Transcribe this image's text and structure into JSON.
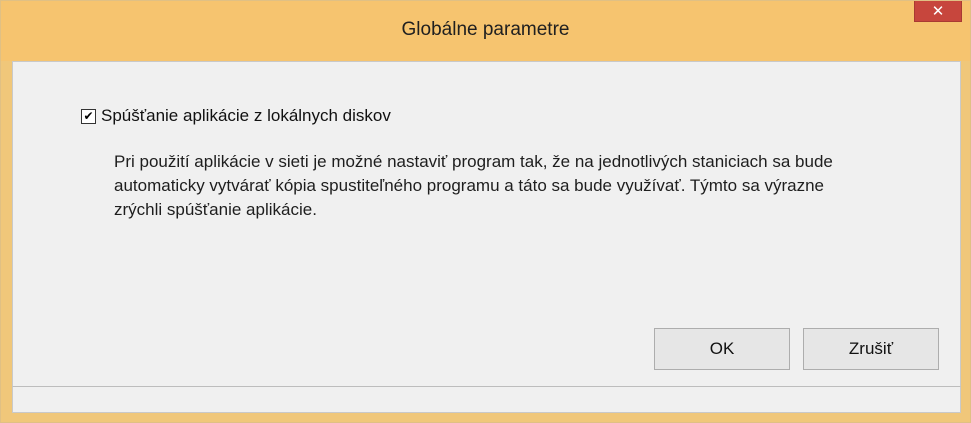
{
  "window": {
    "title": "Globálne parametre",
    "close_glyph": "✕"
  },
  "option": {
    "checked": true,
    "label": "Spúšťanie aplikácie z lokálnych diskov",
    "description": "Pri použití aplikácie v sieti je možné nastaviť program tak, že na jednotlivých staniciach sa bude automaticky vytvárať kópia spustiteľného programu a táto sa bude využívať. Týmto sa výrazne zrýchli spúšťanie aplikácie."
  },
  "buttons": {
    "ok": "OK",
    "cancel": "Zrušiť"
  },
  "statusbar": {
    "text": ""
  },
  "colors": {
    "titlebar": "#f6c46f",
    "close": "#c7463d",
    "client": "#f0f0f0"
  }
}
